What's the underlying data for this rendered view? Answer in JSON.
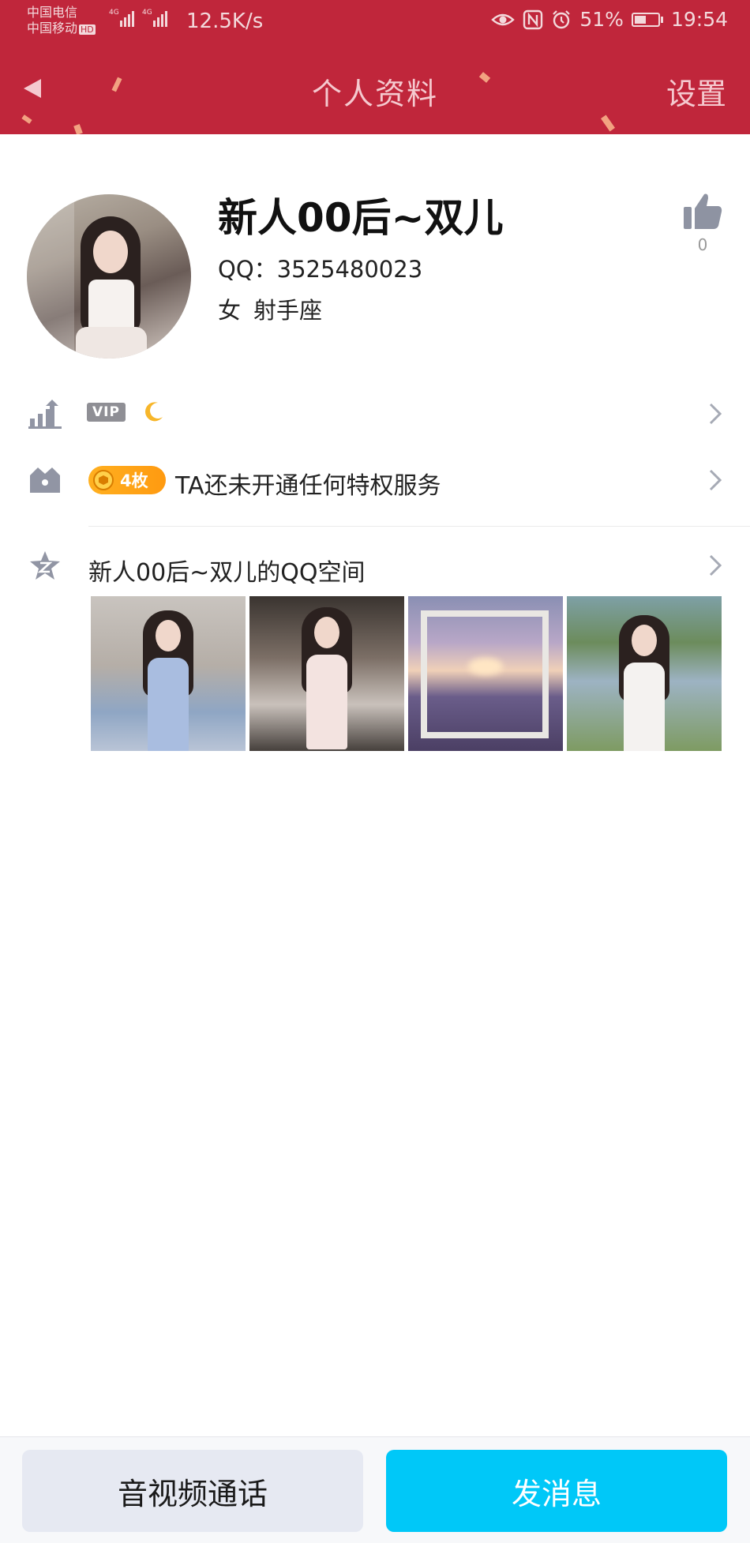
{
  "status_bar": {
    "carrier_1": "中国电信",
    "carrier_2": "中国移动",
    "hd_label": "HD",
    "net_type_1": "4G",
    "net_type_2": "4G",
    "net_speed": "12.5K/s",
    "battery_percent": "51%",
    "battery_level": 0.51,
    "time": "19:54"
  },
  "header": {
    "title": "个人资料",
    "settings_label": "设置",
    "background_color": "#c0263b"
  },
  "profile": {
    "nickname": "新人00后~双儿",
    "qq_label": "QQ：",
    "qq_number": "3525480023",
    "gender": "女",
    "zodiac": "射手座",
    "like_count": "0"
  },
  "rows": {
    "vip_badge": "VIP",
    "coins_count": "4枚",
    "privilege_text": "TA还未开通任何特权服务",
    "qzone_title": "新人00后~双儿的QQ空间"
  },
  "bottom": {
    "call_label": "音视频通话",
    "message_label": "发消息",
    "message_color": "#00c8f8"
  }
}
